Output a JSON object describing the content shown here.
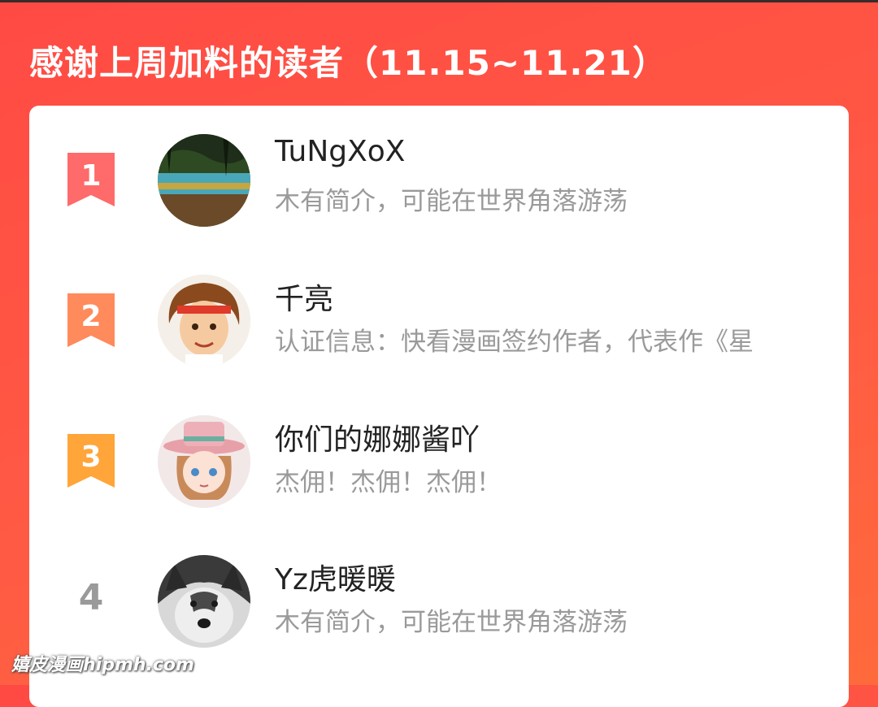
{
  "header": {
    "title": "感谢上周加料的读者（11.15~11.21）"
  },
  "leaderboard": [
    {
      "rank": "1",
      "name": "TuNgXoX",
      "bio": "木有简介，可能在世界角落游荡",
      "badge_color": "#ff6a6a",
      "avatar": "lake-scenery-avatar"
    },
    {
      "rank": "2",
      "name": "千亮",
      "bio": "认证信息：快看漫画签约作者，代表作《星",
      "badge_color": "#ff8a5c",
      "avatar": "anime-boy-headband-avatar"
    },
    {
      "rank": "3",
      "name": "你们的娜娜酱吖",
      "bio": "杰佣！杰佣！杰佣！",
      "badge_color": "#ffa53a",
      "avatar": "anime-girl-pink-hat-avatar"
    },
    {
      "rank": "4",
      "name": "Yz虎暖暖",
      "bio": "木有简介，可能在世界角落游荡",
      "badge_color": "#9a9a9a",
      "avatar": "husky-dog-avatar"
    }
  ],
  "watermark": "嬉皮漫画hipmh.com"
}
